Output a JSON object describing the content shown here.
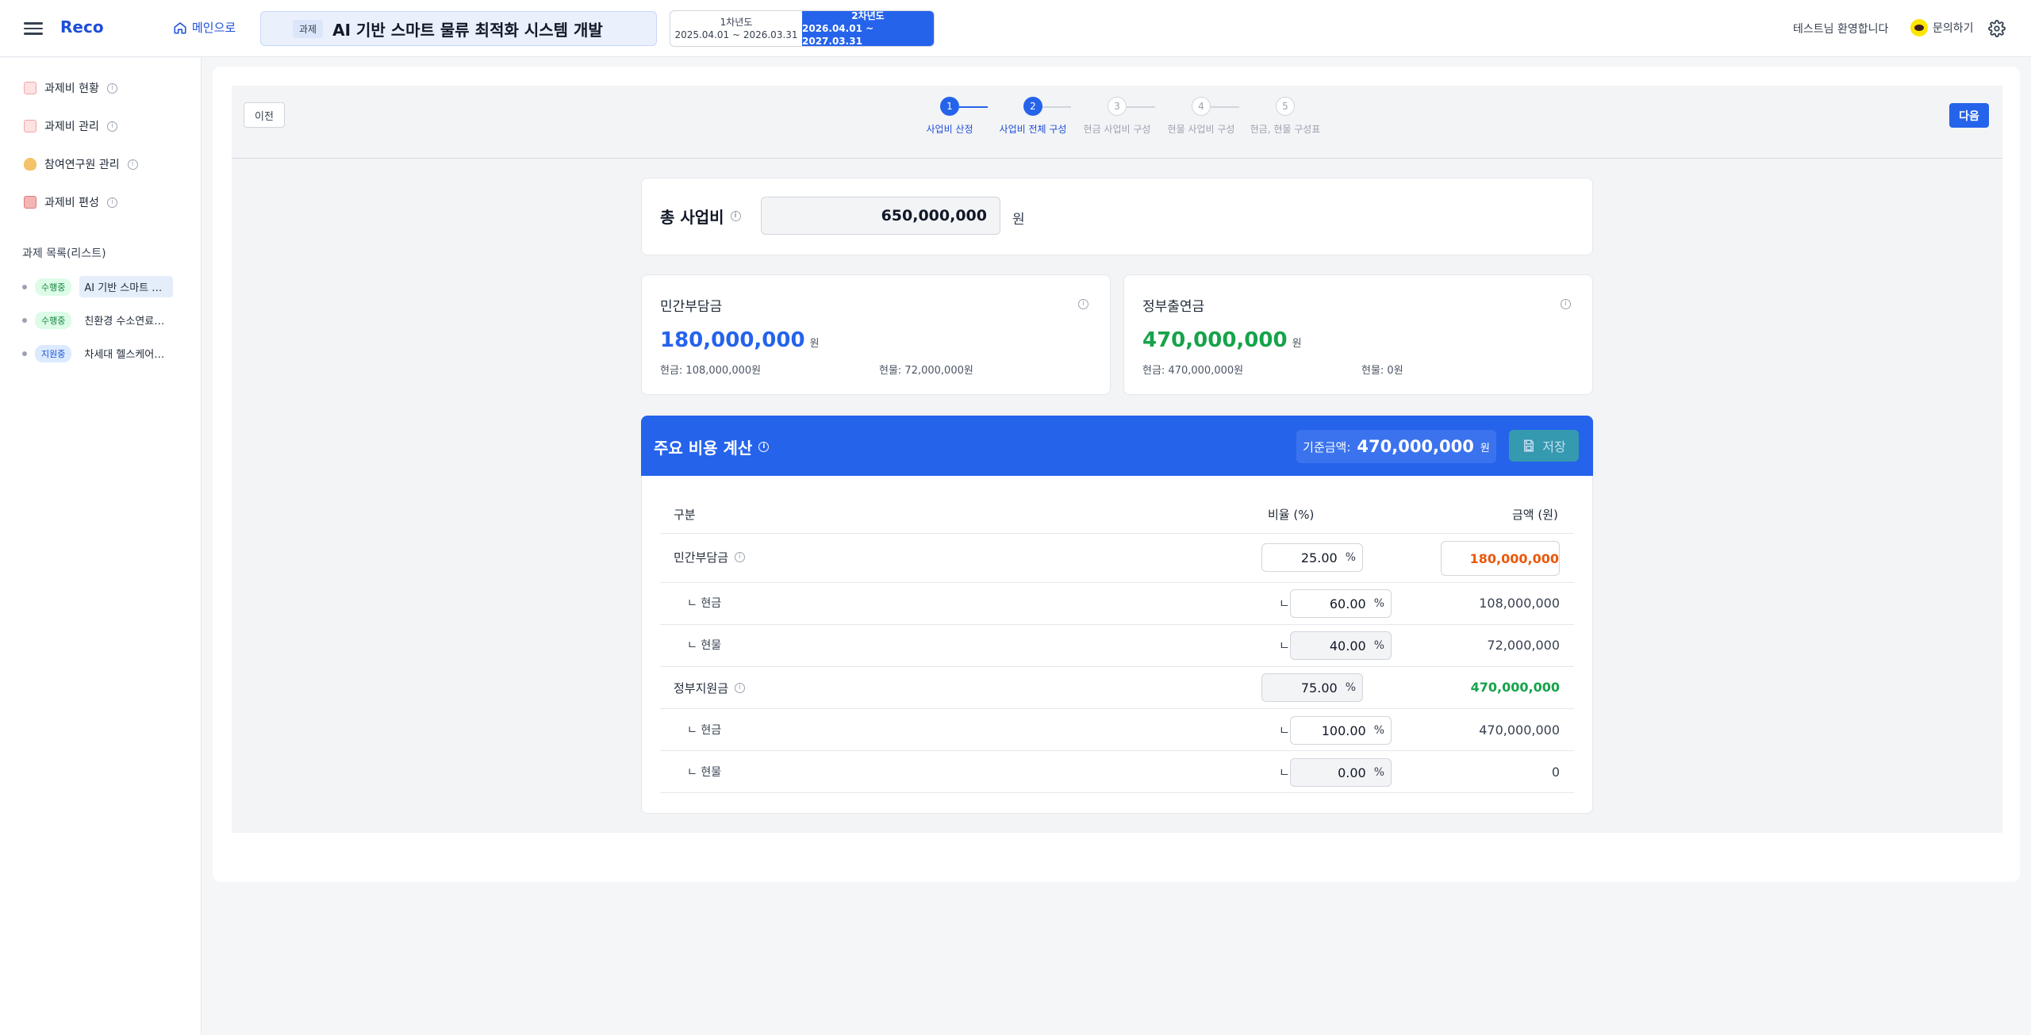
{
  "header": {
    "logo": "Reco",
    "home_link": "메인으로",
    "project_tag": "과제",
    "project_title": "AI 기반 스마트 물류 최적화 시스템 개발",
    "years": [
      {
        "title": "1차년도",
        "range": "2025.04.01 ~ 2026.03.31"
      },
      {
        "title": "2차년도",
        "range": "2026.04.01 ~ 2027.03.31"
      }
    ],
    "welcome": "테스트님 환영합니다",
    "inquiry": "문의하기"
  },
  "sidebar": {
    "items": [
      {
        "label": "과제비 현황",
        "icon": "clipboard-icon"
      },
      {
        "label": "과제비 관리",
        "icon": "clipboard-icon"
      },
      {
        "label": "참여연구원 관리",
        "icon": "money-bag-icon"
      },
      {
        "label": "과제비 편성",
        "icon": "ledger-icon"
      }
    ],
    "section_title": "과제 목록(리스트)",
    "projects": [
      {
        "status": "수행중",
        "name": "AI 기반 스마트 …"
      },
      {
        "status": "수행중",
        "name": "친환경 수소연료…"
      },
      {
        "status": "지원중",
        "name": "차세대 헬스케어…"
      }
    ]
  },
  "stepbar": {
    "prev": "이전",
    "next": "다음",
    "steps": [
      {
        "num": "1",
        "label": "사업비 산정"
      },
      {
        "num": "2",
        "label": "사업비 전체 구성"
      },
      {
        "num": "3",
        "label": "현금 사업비 구성"
      },
      {
        "num": "4",
        "label": "현물 사업비 구성"
      },
      {
        "num": "5",
        "label": "현금, 현물 구성표"
      }
    ]
  },
  "total": {
    "label": "총 사업비",
    "value": "650,000,000",
    "unit": "원"
  },
  "private": {
    "title": "민간부담금",
    "amount": "180,000,000",
    "unit": "원",
    "cash": "현금: 108,000,000원",
    "inkind": "현물: 72,000,000원"
  },
  "government": {
    "title": "정부출연금",
    "amount": "470,000,000",
    "unit": "원",
    "cash": "현금: 470,000,000원",
    "inkind": "현물: 0원"
  },
  "calc": {
    "title": "주요 비용 계산",
    "base_label": "기준금액:",
    "base_value": "470,000,000",
    "base_unit": "원",
    "save": "저장",
    "col_category": "구분",
    "col_ratio": "비율 (%)",
    "col_amount": "금액 (원)",
    "corner": "ㄴ",
    "pct": "%",
    "rows": [
      {
        "label": "민간부담금",
        "ratio": "25.00",
        "amount": "180,000,000"
      },
      {
        "label": "ㄴ 현금",
        "ratio": "60.00",
        "amount": "108,000,000"
      },
      {
        "label": "ㄴ 현물",
        "ratio": "40.00",
        "amount": "72,000,000"
      },
      {
        "label": "정부지원금",
        "ratio": "75.00",
        "amount": "470,000,000"
      },
      {
        "label": "ㄴ 현금",
        "ratio": "100.00",
        "amount": "470,000,000"
      },
      {
        "label": "ㄴ 현물",
        "ratio": "0.00",
        "amount": "0"
      }
    ]
  },
  "colors": {
    "accent": "#2563eb",
    "green": "#16a34a",
    "orange": "#ea580c"
  }
}
